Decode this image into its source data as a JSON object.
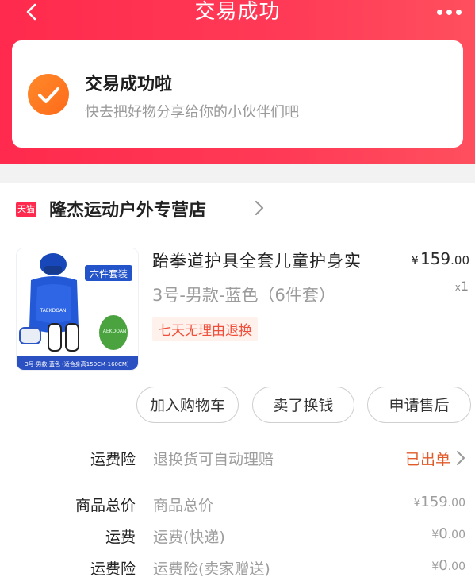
{
  "header": {
    "title": "交易成功"
  },
  "success_card": {
    "title": "交易成功啦",
    "subtitle": "快去把好物分享给你的小伙伴们吧"
  },
  "store": {
    "badge": "天猫",
    "name": "隆杰运动户外专营店"
  },
  "product": {
    "title": "跆拳道护具全套儿童护身实",
    "variant": "3号-男款-蓝色（6件套）",
    "price_currency": "¥",
    "price_int": "159",
    "price_dec": ".00",
    "qty_x": "x",
    "qty": "1",
    "return_badge": "七天无理由退换",
    "thumb": {
      "tag": "六件套装",
      "caption": "3号-男款-蓝色 (适合身高150CM-160CM)",
      "chest_text": "TAEKDOAN",
      "bag_text": "TAEKDOAN"
    }
  },
  "actions": {
    "add_to_cart": "加入购物车",
    "sell_for_cash": "卖了换钱",
    "after_sale": "申请售后"
  },
  "shipping_insurance": {
    "label": "运费险",
    "desc": "退换货可自动理赔",
    "status": "已出单"
  },
  "summary": [
    {
      "label": "商品总价",
      "desc": "商品总价",
      "cur": "¥",
      "int": "159",
      "dec": ".00"
    },
    {
      "label": "运费",
      "desc": "运费(快递)",
      "cur": "¥",
      "int": "0",
      "dec": ".00"
    },
    {
      "label": "运费险",
      "desc": "运费险(卖家赠送)",
      "cur": "¥",
      "int": "0",
      "dec": ".00"
    }
  ],
  "colors": {
    "brand_red": "#ff2a4d",
    "accent_orange": "#ff7a1f",
    "status_orange": "#e05a2a"
  }
}
